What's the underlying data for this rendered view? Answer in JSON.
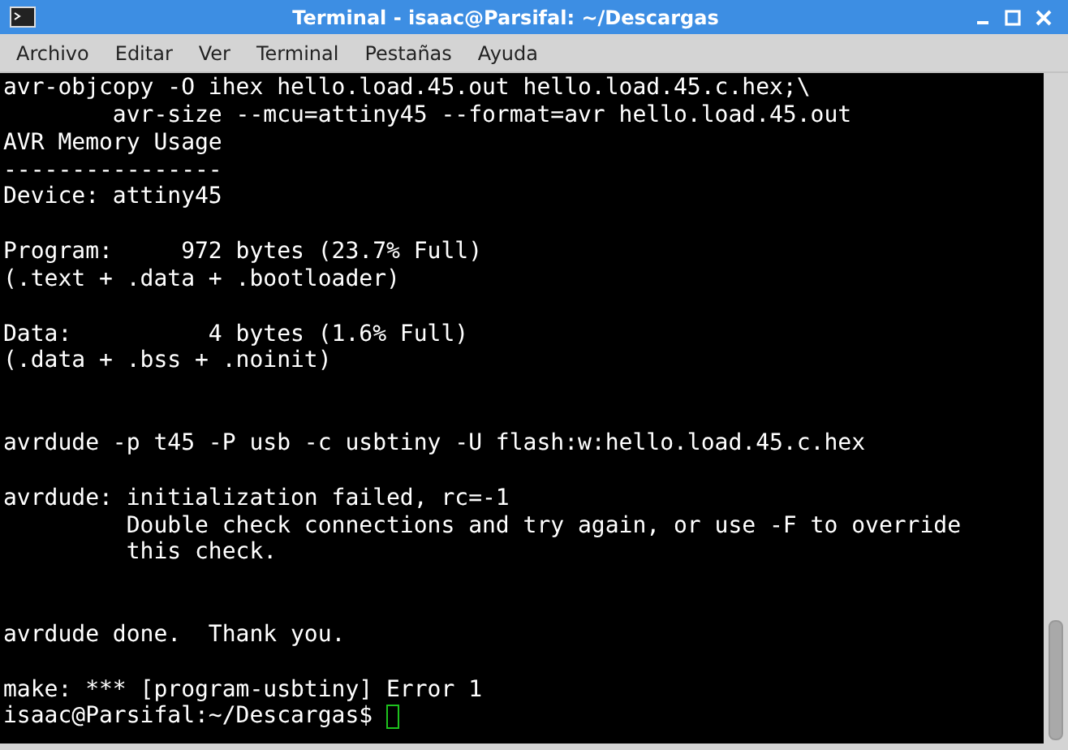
{
  "window": {
    "title": "Terminal - isaac@Parsifal: ~/Descargas"
  },
  "menu": [
    {
      "label": "Archivo"
    },
    {
      "label": "Editar"
    },
    {
      "label": "Ver"
    },
    {
      "label": "Terminal"
    },
    {
      "label": "Pestañas"
    },
    {
      "label": "Ayuda"
    }
  ],
  "terminal": {
    "lines": [
      {
        "kind": "text",
        "text": "avr-objcopy -O ihex hello.load.45.out hello.load.45.c.hex;\\"
      },
      {
        "kind": "text",
        "text": "        avr-size --mcu=attiny45 --format=avr hello.load.45.out"
      },
      {
        "kind": "text",
        "text": "AVR Memory Usage"
      },
      {
        "kind": "text",
        "text": "----------------"
      },
      {
        "kind": "text",
        "text": "Device: attiny45"
      },
      {
        "kind": "blank"
      },
      {
        "kind": "text",
        "text": "Program:     972 bytes (23.7% Full)"
      },
      {
        "kind": "text",
        "text": "(.text + .data + .bootloader)"
      },
      {
        "kind": "blank"
      },
      {
        "kind": "text",
        "text": "Data:          4 bytes (1.6% Full)"
      },
      {
        "kind": "text",
        "text": "(.data + .bss + .noinit)"
      },
      {
        "kind": "blank"
      },
      {
        "kind": "blank"
      },
      {
        "kind": "text",
        "text": "avrdude -p t45 -P usb -c usbtiny -U flash:w:hello.load.45.c.hex"
      },
      {
        "kind": "blank"
      },
      {
        "kind": "text",
        "text": "avrdude: initialization failed, rc=-1"
      },
      {
        "kind": "text",
        "text": "         Double check connections and try again, or use -F to override"
      },
      {
        "kind": "text",
        "text": "         this check."
      },
      {
        "kind": "blank"
      },
      {
        "kind": "blank"
      },
      {
        "kind": "text",
        "text": "avrdude done.  Thank you."
      },
      {
        "kind": "blank"
      },
      {
        "kind": "text",
        "text": "make: *** [program-usbtiny] Error 1"
      }
    ],
    "prompt": "isaac@Parsifal:~/Descargas$"
  }
}
